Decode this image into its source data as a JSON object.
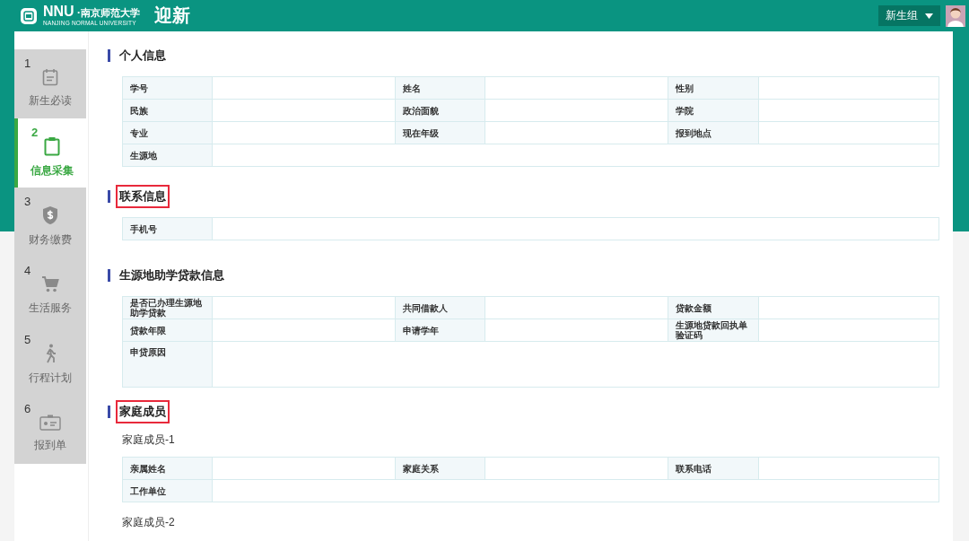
{
  "header": {
    "logo_text": "NNU",
    "logo_chinese": "·南京师范大学",
    "logo_english": "NANJING NORMAL UNIVERSITY",
    "title": "迎新",
    "user_menu": "新生组"
  },
  "steps": [
    {
      "number": "1",
      "label": "新生必读",
      "selected": false
    },
    {
      "number": "2",
      "label": "信息采集",
      "selected": true
    },
    {
      "number": "3",
      "label": "财务缴费",
      "selected": false
    },
    {
      "number": "4",
      "label": "生活服务",
      "selected": false
    },
    {
      "number": "5",
      "label": "行程计划",
      "selected": false
    },
    {
      "number": "6",
      "label": "报到单",
      "selected": false
    }
  ],
  "sections": [
    {
      "title": "个人信息",
      "highlighted": false,
      "groups": [
        {
          "rows": [
            [
              {
                "label": "学号",
                "kind": "normal"
              },
              {
                "label": "姓名",
                "kind": "normal"
              },
              {
                "label": "性别",
                "kind": "normal"
              }
            ],
            [
              {
                "label": "民族",
                "kind": "normal"
              },
              {
                "label": "政治面貌",
                "kind": "normal"
              },
              {
                "label": "学院",
                "kind": "normal"
              }
            ],
            [
              {
                "label": "专业",
                "kind": "normal"
              },
              {
                "label": "现在年级",
                "kind": "normal"
              },
              {
                "label": "报到地点",
                "kind": "normal"
              }
            ],
            [
              {
                "label": "生源地",
                "kind": "wide"
              }
            ]
          ]
        }
      ]
    },
    {
      "title": "联系信息",
      "highlighted": true,
      "groups": [
        {
          "rows": [
            [
              {
                "label": "手机号",
                "kind": "wide"
              }
            ]
          ]
        }
      ]
    },
    {
      "title": "生源地助学贷款信息",
      "highlighted": false,
      "groups": [
        {
          "rows": [
            [
              {
                "label": "是否已办理生源地助学贷款",
                "kind": "normal"
              },
              {
                "label": "共同借款人",
                "kind": "normal"
              },
              {
                "label": "贷款金额",
                "kind": "normal"
              }
            ],
            [
              {
                "label": "贷款年限",
                "kind": "normal"
              },
              {
                "label": "申请学年",
                "kind": "normal"
              },
              {
                "label": "生源地贷款回执单验证码",
                "kind": "normal"
              }
            ],
            [
              {
                "label": "申贷原因",
                "kind": "tall"
              }
            ]
          ]
        }
      ]
    },
    {
      "title": "家庭成员",
      "highlighted": true,
      "groups": [
        {
          "subtitle": "家庭成员-1",
          "rows": [
            [
              {
                "label": "亲属姓名",
                "kind": "normal"
              },
              {
                "label": "家庭关系",
                "kind": "normal"
              },
              {
                "label": "联系电话",
                "kind": "normal"
              }
            ],
            [
              {
                "label": "工作单位",
                "kind": "wide"
              }
            ]
          ]
        },
        {
          "subtitle": "家庭成员-2"
        }
      ]
    }
  ]
}
